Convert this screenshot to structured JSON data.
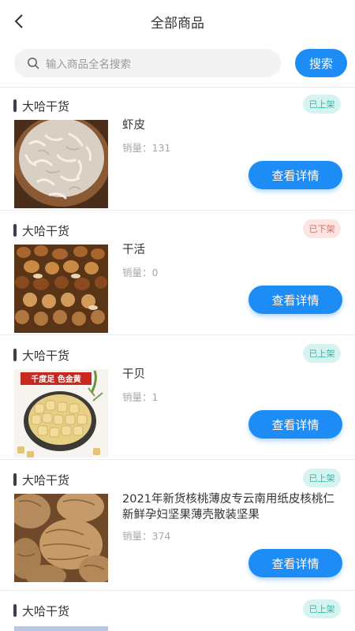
{
  "header": {
    "title": "全部商品",
    "back_icon": "chevron-left-icon"
  },
  "search": {
    "placeholder": "输入商品全名搜索",
    "button_label": "搜索",
    "icon": "search-icon"
  },
  "colors": {
    "accent": "#1e8cf5",
    "badge_on": "#35b6a6",
    "badge_off": "#e06a62"
  },
  "products": [
    {
      "shop": "大哈干货",
      "status": "已上架",
      "name": "虾皮",
      "sales": "销量：131",
      "button": "查看详情"
    },
    {
      "shop": "大哈干货",
      "status": "已下架",
      "name": "干活",
      "sales": "销量：0",
      "button": "查看详情"
    },
    {
      "shop": "大哈干货",
      "status": "已上架",
      "name": "干贝",
      "sales": "销量：1",
      "button": "查看详情",
      "image_text": "千度足 色金黄"
    },
    {
      "shop": "大哈干货",
      "status": "已上架",
      "name": "2021年新货核桃薄皮专云南用纸皮核桃仁新鲜孕妇坚果薄壳散装坚果",
      "sales": "销量：374",
      "button": "查看详情"
    },
    {
      "shop": "大哈干货",
      "status": "已上架"
    }
  ]
}
